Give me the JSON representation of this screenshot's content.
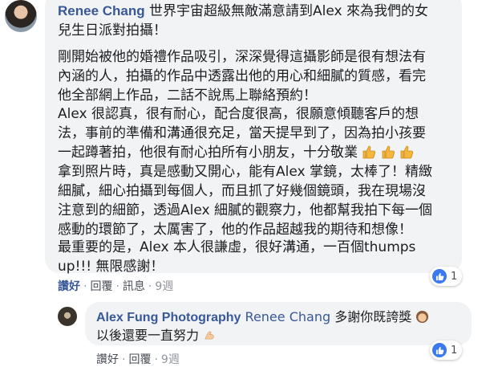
{
  "comment": {
    "author": "Renee Chang",
    "paragraphs": [
      [
        "世界宇宙超級無敵滿意請到Alex 來為我們的女",
        "兒生日派對拍攝！"
      ],
      [
        "剛開始被他的婚禮作品吸引，深深覺得這攝影師是很有想法有",
        "內涵的人，拍攝的作品中透露出他的用心和細膩的質感，看完",
        "他全部網上作品，二話不說馬上聯絡預約！"
      ],
      [
        "Alex 很認真，很有耐心，配合度很高，很願意傾聽客戶的想",
        "法，事前的準備和溝通很充足，當天提早到了，因為拍小孩要",
        "一起蹲著拍，他很有耐心拍所有小朋友，十分敬業"
      ],
      [
        "拿到照片時，真是感動又開心，能有Alex 掌鏡，太棒了！精緻",
        "細膩，細心拍攝到每個人，而且抓了好幾個鏡頭，我在現場沒",
        "注意到的細節，透過Alex 細膩的觀察力，他都幫我拍下每一個",
        "感動的環節了，太厲害了，他的作品超越我的期待和想像！"
      ],
      [
        "最重要的是，Alex 本人很謙虛，很好溝通，一百個thumps",
        "up!!! 無限感謝！"
      ]
    ],
    "thumbs_emoji_count": 3,
    "actions": {
      "like": "讚好",
      "reply": "回覆",
      "message": "訊息",
      "time": "9週"
    },
    "reaction_count": "1"
  },
  "reply": {
    "author": "Alex Fung Photography",
    "mention": "Renee Chang",
    "line1": "多謝你既誇獎",
    "line2": "以後還要一直努力",
    "actions": {
      "like": "讚好",
      "reply": "回覆",
      "time": "9週"
    },
    "reaction_count": "1"
  },
  "colors": {
    "link": "#385898",
    "bubble": "#f2f3f5",
    "like_blue": "#3b79f0"
  },
  "icons": [
    "thumbs-up-emoji",
    "woman-emoji",
    "flexed-biceps-emoji",
    "like-reaction-icon"
  ]
}
